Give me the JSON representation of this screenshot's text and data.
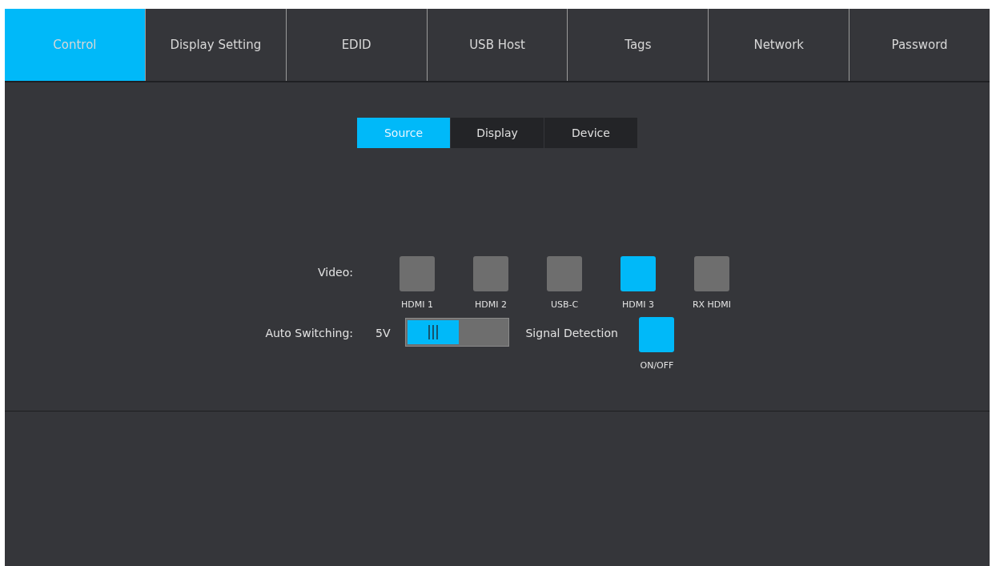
{
  "tabs": [
    {
      "label": "Control",
      "selected": true
    },
    {
      "label": "Display Setting",
      "selected": false
    },
    {
      "label": "EDID",
      "selected": false
    },
    {
      "label": "USB Host",
      "selected": false
    },
    {
      "label": "Tags",
      "selected": false
    },
    {
      "label": "Network",
      "selected": false
    },
    {
      "label": "Password",
      "selected": false
    }
  ],
  "subtabs": [
    {
      "label": "Source",
      "selected": true
    },
    {
      "label": "Display",
      "selected": false
    },
    {
      "label": "Device",
      "selected": false
    }
  ],
  "video": {
    "label": "Video:",
    "sources": [
      {
        "label": "HDMI 1",
        "selected": false
      },
      {
        "label": "HDMI 2",
        "selected": false
      },
      {
        "label": "USB-C",
        "selected": false
      },
      {
        "label": "HDMI 3",
        "selected": true
      },
      {
        "label": "RX HDMI",
        "selected": false
      }
    ]
  },
  "auto_switching": {
    "label": "Auto Switching:",
    "switch_label": "5V",
    "on": true,
    "signal_label": "Signal Detection",
    "signal_on": true,
    "signal_caption": "ON/OFF"
  }
}
